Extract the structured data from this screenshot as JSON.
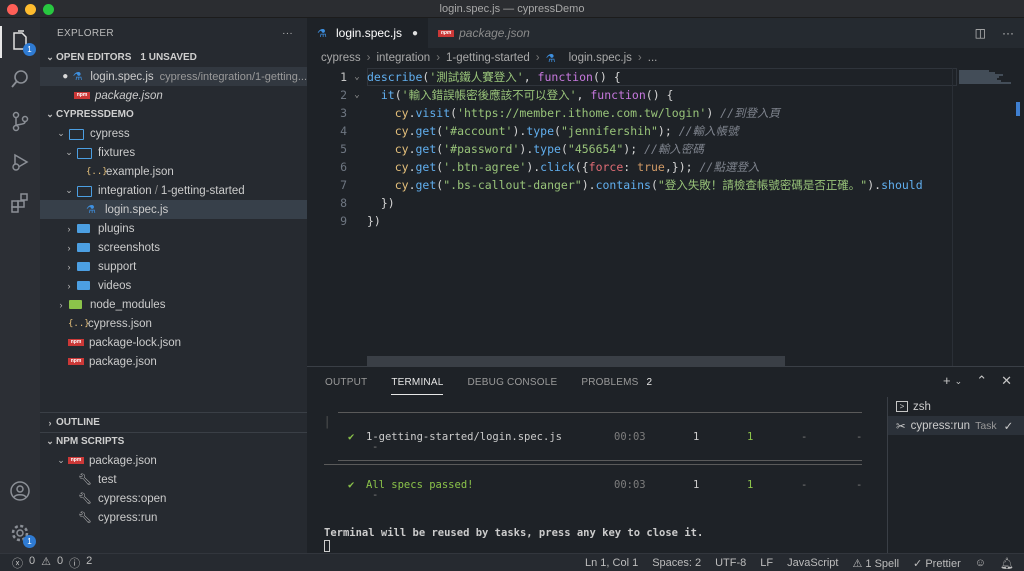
{
  "window": {
    "title": "login.spec.js — cypressDemo"
  },
  "activity": {
    "explorer_badge": "1",
    "settings_badge": "1"
  },
  "sidebar": {
    "header": "EXPLORER",
    "more": "···",
    "open_editors": {
      "title": "OPEN EDITORS",
      "unsaved": "1 UNSAVED",
      "items": [
        {
          "name": "login.spec.js",
          "desc": "cypress/integration/1-getting..."
        },
        {
          "name": "package.json"
        }
      ]
    },
    "project": {
      "title": "CYPRESSDEMO"
    },
    "tree": {
      "cypress": "cypress",
      "fixtures": "fixtures",
      "example_json": "example.json",
      "integration": "integration",
      "integration_sub": "1-getting-started",
      "login_spec": "login.spec.js",
      "plugins": "plugins",
      "screenshots": "screenshots",
      "support": "support",
      "videos": "videos",
      "node_modules": "node_modules",
      "cypress_json": "cypress.json",
      "package_lock": "package-lock.json",
      "package_json": "package.json"
    },
    "outline": "OUTLINE",
    "npm_scripts": {
      "title": "NPM SCRIPTS",
      "file": "package.json",
      "scripts": [
        "test",
        "cypress:open",
        "cypress:run"
      ]
    }
  },
  "tabs": [
    {
      "label": "login.spec.js",
      "active": true
    },
    {
      "label": "package.json",
      "active": false
    }
  ],
  "breadcrumb": [
    "cypress",
    "integration",
    "1-getting-started",
    "login.spec.js",
    "..."
  ],
  "editor": {
    "line_numbers": [
      "1",
      "2",
      "3",
      "4",
      "5",
      "6",
      "7",
      "8",
      "9"
    ],
    "lines": [
      {
        "indent": "",
        "parts": [
          [
            "fn",
            "describe"
          ],
          [
            "code",
            "("
          ],
          [
            "str",
            "'測試鐵人賽登入'"
          ],
          [
            "code",
            ", "
          ],
          [
            "kw",
            "function"
          ],
          [
            "code",
            "() {"
          ]
        ]
      },
      {
        "indent": "  ",
        "parts": [
          [
            "fn",
            "it"
          ],
          [
            "code",
            "("
          ],
          [
            "str",
            "'輸入錯誤帳密後應該不可以登入'"
          ],
          [
            "code",
            ", "
          ],
          [
            "kw",
            "function"
          ],
          [
            "code",
            "() {"
          ]
        ]
      },
      {
        "indent": "    ",
        "parts": [
          [
            "obj",
            "cy"
          ],
          [
            "code",
            "."
          ],
          [
            "fn",
            "visit"
          ],
          [
            "code",
            "("
          ],
          [
            "str",
            "'https://member.ithome.com.tw/login'"
          ],
          [
            "code",
            ") "
          ],
          [
            "cm",
            "//到登入頁"
          ]
        ]
      },
      {
        "indent": "    ",
        "parts": [
          [
            "obj",
            "cy"
          ],
          [
            "code",
            "."
          ],
          [
            "fn",
            "get"
          ],
          [
            "code",
            "("
          ],
          [
            "str",
            "'#account'"
          ],
          [
            "code",
            ")."
          ],
          [
            "fn",
            "type"
          ],
          [
            "code",
            "("
          ],
          [
            "str",
            "\"jennifershih\""
          ],
          [
            "code",
            "); "
          ],
          [
            "cm",
            "//輸入帳號"
          ]
        ]
      },
      {
        "indent": "    ",
        "parts": [
          [
            "obj",
            "cy"
          ],
          [
            "code",
            "."
          ],
          [
            "fn",
            "get"
          ],
          [
            "code",
            "("
          ],
          [
            "str",
            "'#password'"
          ],
          [
            "code",
            ")."
          ],
          [
            "fn",
            "type"
          ],
          [
            "code",
            "("
          ],
          [
            "str",
            "\"456654\""
          ],
          [
            "code",
            "); "
          ],
          [
            "cm",
            "//輸入密碼"
          ]
        ]
      },
      {
        "indent": "    ",
        "parts": [
          [
            "obj",
            "cy"
          ],
          [
            "code",
            "."
          ],
          [
            "fn",
            "get"
          ],
          [
            "code",
            "("
          ],
          [
            "str",
            "'.btn-agree'"
          ],
          [
            "code",
            ")."
          ],
          [
            "fn",
            "click"
          ],
          [
            "code",
            "({"
          ],
          [
            "prop",
            "force"
          ],
          [
            "code",
            ": "
          ],
          [
            "bool",
            "true"
          ],
          [
            "code",
            ",}); "
          ],
          [
            "cm",
            "//點選登入"
          ]
        ]
      },
      {
        "indent": "    ",
        "parts": [
          [
            "obj",
            "cy"
          ],
          [
            "code",
            "."
          ],
          [
            "fn",
            "get"
          ],
          [
            "code",
            "("
          ],
          [
            "str",
            "\".bs-callout-danger\""
          ],
          [
            "code",
            ")."
          ],
          [
            "fn",
            "contains"
          ],
          [
            "code",
            "("
          ],
          [
            "str",
            "\"登入失敗！請檢查帳號密碼是否正確。\""
          ],
          [
            "code",
            ")."
          ],
          [
            "fn",
            "should"
          ]
        ]
      },
      {
        "indent": "  ",
        "parts": [
          [
            "code",
            "})"
          ]
        ]
      },
      {
        "indent": "",
        "parts": [
          [
            "code",
            "})"
          ]
        ]
      }
    ]
  },
  "panel": {
    "tabs": [
      "OUTPUT",
      "TERMINAL",
      "DEBUG CONSOLE",
      "PROBLEMS"
    ],
    "problems_count": "2",
    "terminal": {
      "row1": {
        "check": "✔",
        "spec": "1-getting-started/login.spec.js",
        "time": "00:03",
        "tests": "1",
        "passing": "1",
        "failing": "-",
        "pending": "-",
        "skipped": "-"
      },
      "row2": {
        "check": "✔",
        "spec": "All specs passed!",
        "time": "00:03",
        "tests": "1",
        "passing": "1",
        "failing": "-",
        "pending": "-",
        "skipped": "-"
      },
      "message": "Terminal will be reused by tasks, press any key to close it."
    },
    "terminals": [
      {
        "label": "zsh"
      },
      {
        "label": "cypress:run",
        "tag": "Task"
      }
    ]
  },
  "status": {
    "errors": "0",
    "warnings": "0",
    "info": "2",
    "position": "Ln 1, Col 1",
    "spaces": "Spaces: 2",
    "encoding": "UTF-8",
    "eol": "LF",
    "language": "JavaScript",
    "spell": "1 Spell",
    "prettier": "Prettier"
  }
}
